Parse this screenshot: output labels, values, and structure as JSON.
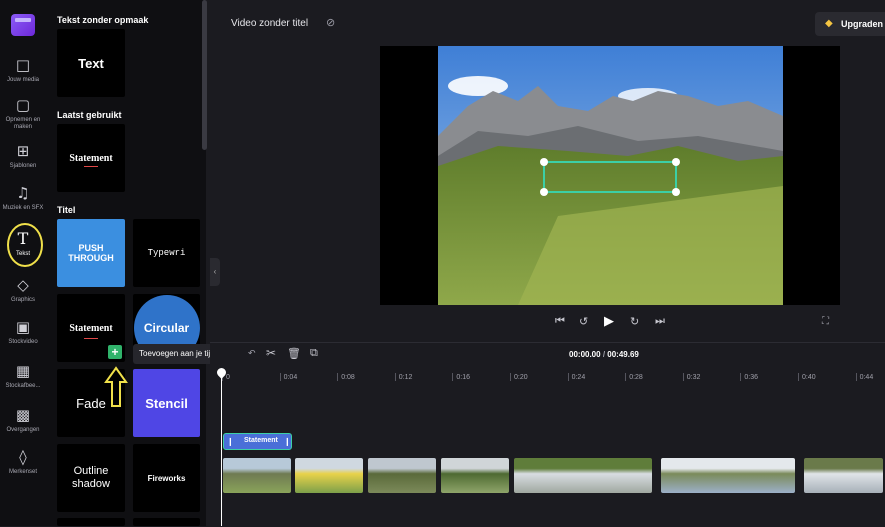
{
  "sidebar": {
    "items": [
      {
        "label": "Jouw media",
        "icon": "folder-icon"
      },
      {
        "label": "Opnemen en maken",
        "icon": "camera-icon"
      },
      {
        "label": "Sjablonen",
        "icon": "templates-icon"
      },
      {
        "label": "Muziek en SFX",
        "icon": "music-icon"
      },
      {
        "label": "Tekst",
        "icon": "text-icon"
      },
      {
        "label": "Graphics",
        "icon": "shapes-icon"
      },
      {
        "label": "Stockvideo",
        "icon": "film-icon"
      },
      {
        "label": "Stockafbee...",
        "icon": "image-icon"
      },
      {
        "label": "Overgangen",
        "icon": "transition-icon"
      },
      {
        "label": "Merkenset",
        "icon": "brand-kit-icon"
      }
    ]
  },
  "panel": {
    "section_plain": "Tekst zonder opmaak",
    "section_recent": "Laatst gebruikt",
    "section_title": "Titel",
    "tiles": {
      "text": "Text",
      "statement_recent": "Statement",
      "push_through": "PUSH THROUGH",
      "typewriter": "Typewri",
      "statement": "Statement",
      "circular": "Circular",
      "fade": "Fade",
      "stencil": "Stencil",
      "outline_shadow": "Outline shadow",
      "fireworks": "Fireworks"
    },
    "add_button": "+",
    "tooltip": "Toevoegen aan je tijdlijn"
  },
  "header": {
    "project_title": "Video zonder titel",
    "upgrade_label": "Upgraden"
  },
  "timeline": {
    "time_current": "00:00.00",
    "time_total": "00:49.69",
    "ticks": [
      "0",
      "0:04",
      "0:08",
      "0:12",
      "0:16",
      "0:20",
      "0:24",
      "0:28",
      "0:32",
      "0:36",
      "0:40",
      "0:44"
    ],
    "text_clip_label": "Statement"
  },
  "colors": {
    "accent": "#8b5cf6",
    "annotation_yellow": "#f0e04a",
    "selection_teal": "#3ccfa6",
    "push_through_bg": "#3b8fe0",
    "stencil_bg": "#4f46e5",
    "circular_bg": "#2f73c9"
  }
}
